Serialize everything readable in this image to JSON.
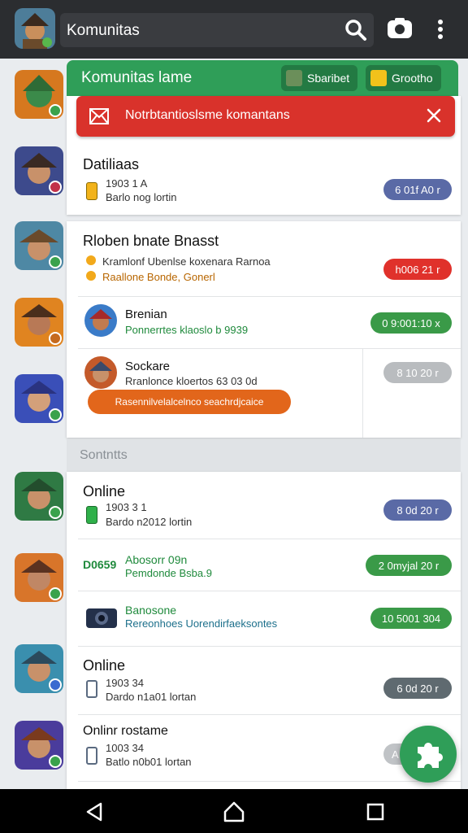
{
  "appbar": {
    "title": "Komunitas",
    "icons": [
      "app-avatar-icon",
      "search-icon",
      "camera-icon",
      "more-vert-icon"
    ]
  },
  "panel": {
    "title": "Komunitas lame",
    "btn_a": "Sbaribet",
    "btn_b": "Grootho"
  },
  "alert": {
    "text": "Notrbtantioslsme komantans",
    "color": "#d9322b"
  },
  "card1": {
    "title": "Datiliaas",
    "line1": "1903 1 A",
    "line2": "Barlo nog lortin",
    "pill": "6 01f A0 r",
    "pill_color": "#5a6aa6"
  },
  "card2": {
    "title": "Rloben bnate Bnasst",
    "line1": "Kramlonf Ubenlse koxenara Rarnoa",
    "line2": "Raallone Bonde, Gonerl",
    "pill": "h006 21 r",
    "pill_color": "#e0312b",
    "item1": {
      "name": "Brenian",
      "sub": "Ponnerrtes klaoslo b 9939",
      "pill": "0 9:001:10 x",
      "pill_color": "#3a9a48"
    },
    "item2": {
      "name": "Sockare",
      "sub": "Rranlonce kloertos 63 03 0d",
      "pill": "8 10 20 r",
      "pill_color": "#b9bcbf",
      "action": "Rasennilvelalcelnco seachrdjcaice",
      "action_color": "#e2661b"
    }
  },
  "section": {
    "label": "Sontntts"
  },
  "list": [
    {
      "title": "Online",
      "line1": "1903 3 1",
      "line2": "Bardo n2012 lortin",
      "pill": "8 0d 20 r",
      "pill_color": "#5a6aa6"
    },
    {
      "title": "Abosorr 09n",
      "line1": "Pemdonde Bsba.9",
      "badge": "D0659",
      "pill": "2 0myjal 20 r",
      "pill_color": "#3a9a48"
    },
    {
      "title": "Banosone",
      "line1": "Rereonhoes Uorendirfaeksontes",
      "pill": "10 5001 304",
      "pill_color": "#3a9a48"
    },
    {
      "title": "Online",
      "line1": "1903 34",
      "line2": "Dardo n1a01 lortan",
      "pill": "6 0d 20 r",
      "pill_color": "#5f6a70"
    },
    {
      "title": "Onlinr rostame",
      "line1": "1003 34",
      "line2": "Batlo n0b01 lortan",
      "pill": "A",
      "pill_color": "#c0c3c6"
    }
  ],
  "navbar": {
    "icons": [
      "back-icon",
      "home-icon",
      "recents-icon"
    ]
  }
}
